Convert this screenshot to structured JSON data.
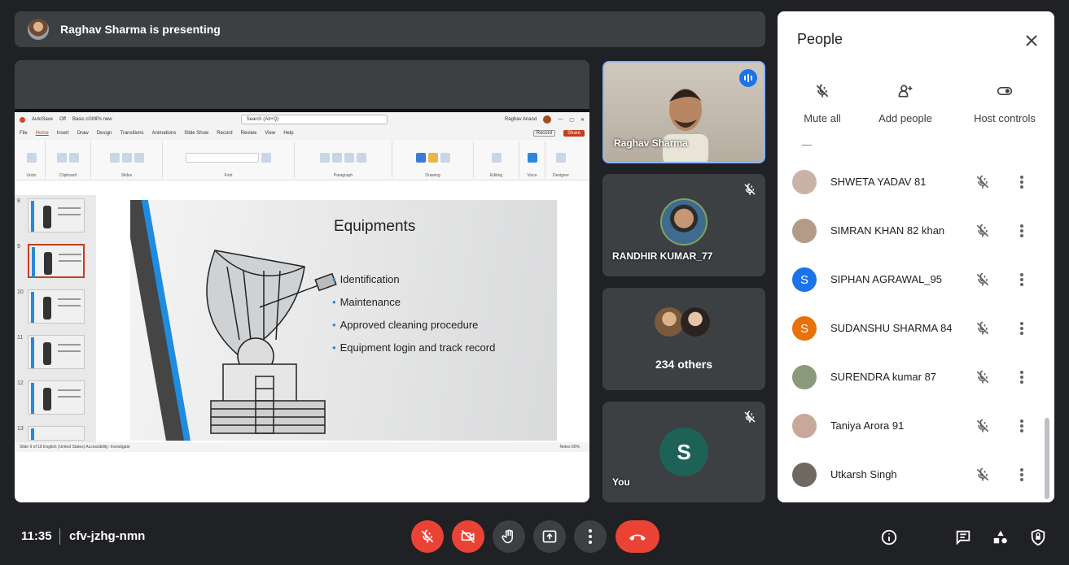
{
  "banner": {
    "text": "Raghav Sharma is presenting"
  },
  "powerpoint": {
    "autosave": "AutoSave",
    "autosave_state": "Off",
    "filename": "Basic cGMPs new",
    "search_placeholder": "Search (Alt+Q)",
    "user": "Raghav Anand",
    "menu": [
      "File",
      "Home",
      "Insert",
      "Draw",
      "Design",
      "Transitions",
      "Animations",
      "Slide Show",
      "Record",
      "Review",
      "View",
      "Help"
    ],
    "record_btn": "Record",
    "share_btn": "Share",
    "ribbon_groups": [
      "Undo",
      "Clipboard",
      "Slides",
      "Font",
      "Paragraph",
      "Drawing",
      "Editing",
      "Voice",
      "Designer"
    ],
    "thumb_numbers": [
      "8",
      "9",
      "10",
      "11",
      "12",
      "13"
    ],
    "slide": {
      "title": "Equipments",
      "bullets": [
        "Identification",
        "Maintenance",
        "Approved cleaning procedure",
        "Equipment login and track record"
      ]
    },
    "status": "Slide 9 of 18    English (United States)    Accessibility: Investigate",
    "status_right": "Notes    60%"
  },
  "tiles": {
    "presenter": "Raghav Sharma",
    "participant": "RANDHIR KUMAR_77",
    "others": "234 others",
    "you_label": "You",
    "you_initial": "S"
  },
  "people": {
    "title": "People",
    "controls": [
      "Mute all",
      "Add people",
      "Host controls"
    ],
    "list": [
      {
        "name": "SHWETA YADAV 81",
        "initial": "",
        "color": "#c9b2a6"
      },
      {
        "name": "SIMRAN KHAN 82 khan",
        "initial": "",
        "color": "#b39b86"
      },
      {
        "name": "SIPHAN AGRAWAL_95",
        "initial": "S",
        "color": "#1a73e8"
      },
      {
        "name": "SUDANSHU SHARMA 84",
        "initial": "S",
        "color": "#e8710a"
      },
      {
        "name": "SURENDRA kumar 87",
        "initial": "",
        "color": "#8a9a7a"
      },
      {
        "name": "Taniya Arora 91",
        "initial": "",
        "color": "#c7a89b"
      },
      {
        "name": "Utkarsh Singh",
        "initial": "",
        "color": "#6f6a60"
      }
    ]
  },
  "meeting": {
    "time": "11:35",
    "code": "cfv-jzhg-nmn"
  },
  "colors": {
    "accent": "#8ab4f8",
    "danger": "#ea4335",
    "surface": "#3c4043"
  }
}
